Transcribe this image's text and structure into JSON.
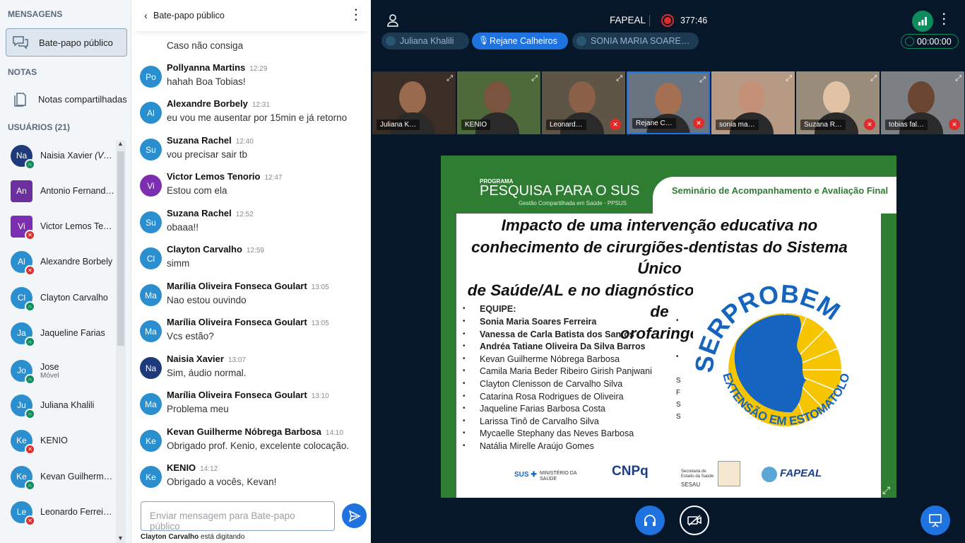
{
  "sidebar": {
    "messages_title": "MENSAGENS",
    "public_chat": "Bate-papo público",
    "notes_title": "NOTAS",
    "shared_notes": "Notas compartilhadas",
    "users_title": "USUÁRIOS (21)",
    "users": [
      {
        "initials": "Na",
        "name": "Naisia Xavier (Você)",
        "sub": "",
        "color": "#1f3a7a",
        "shape": "round",
        "status": "ok"
      },
      {
        "initials": "An",
        "name": "Antonio Fernand…",
        "sub": "",
        "color": "#6b2f9e",
        "shape": "square",
        "status": ""
      },
      {
        "initials": "Vi",
        "name": "Victor Lemos Ten…",
        "sub": "",
        "color": "#7b2fb0",
        "shape": "square",
        "status": "mute"
      },
      {
        "initials": "Al",
        "name": "Alexandre Borbely",
        "sub": "",
        "color": "#2b8fcf",
        "shape": "round",
        "status": "mute"
      },
      {
        "initials": "Cl",
        "name": "Clayton Carvalho",
        "sub": "",
        "color": "#2b8fcf",
        "shape": "round",
        "status": "ok"
      },
      {
        "initials": "Ja",
        "name": "Jaqueline Farias",
        "sub": "",
        "color": "#2b8fcf",
        "shape": "round",
        "status": "ok"
      },
      {
        "initials": "Jo",
        "name": "Jose",
        "sub": "Móvel",
        "color": "#2b8fcf",
        "shape": "round",
        "status": "ok"
      },
      {
        "initials": "Ju",
        "name": "Juliana Khalili",
        "sub": "",
        "color": "#2b8fcf",
        "shape": "round",
        "status": "ok"
      },
      {
        "initials": "Ke",
        "name": "KENIO",
        "sub": "",
        "color": "#2b8fcf",
        "shape": "round",
        "status": "mute"
      },
      {
        "initials": "Ke",
        "name": "Kevan Guilherme…",
        "sub": "",
        "color": "#2b8fcf",
        "shape": "round",
        "status": "ok"
      },
      {
        "initials": "Le",
        "name": "Leonardo Ferreir…",
        "sub": "",
        "color": "#2b8fcf",
        "shape": "round",
        "status": "mute"
      }
    ]
  },
  "chat": {
    "title": "Bate-papo público",
    "partial_text": "Caso não consiga",
    "messages": [
      {
        "initials": "Po",
        "color": "#2b8fcf",
        "name": "Pollyanna Martins",
        "time": "12:29",
        "text": "hahah Boa Tobias!"
      },
      {
        "initials": "Al",
        "color": "#2b8fcf",
        "name": "Alexandre Borbely",
        "time": "12:31",
        "text": "eu vou me ausentar por 15min e já retorno"
      },
      {
        "initials": "Su",
        "color": "#2b8fcf",
        "name": "Suzana Rachel",
        "time": "12:40",
        "text": "vou precisar sair tb"
      },
      {
        "initials": "Vi",
        "color": "#7b2fb0",
        "name": "Victor Lemos Tenorio",
        "time": "12:47",
        "text": "Estou com ela"
      },
      {
        "initials": "Su",
        "color": "#2b8fcf",
        "name": "Suzana Rachel",
        "time": "12:52",
        "text": "obaaa!!"
      },
      {
        "initials": "Cl",
        "color": "#2b8fcf",
        "name": "Clayton Carvalho",
        "time": "12:59",
        "text": "simm"
      },
      {
        "initials": "Ma",
        "color": "#2b8fcf",
        "name": "Marília Oliveira Fonseca Goulart",
        "time": "13:05",
        "text": "Nao estou ouvindo"
      },
      {
        "initials": "Ma",
        "color": "#2b8fcf",
        "name": "Marília Oliveira Fonseca Goulart",
        "time": "13:05",
        "text": "Vcs estão?"
      },
      {
        "initials": "Na",
        "color": "#1f3a7a",
        "name": "Naisia Xavier",
        "time": "13:07",
        "text": "Sim, áudio normal."
      },
      {
        "initials": "Ma",
        "color": "#2b8fcf",
        "name": "Marília Oliveira Fonseca Goulart",
        "time": "13:10",
        "text": "Problema meu"
      },
      {
        "initials": "Ke",
        "color": "#2b8fcf",
        "name": "Kevan Guilherme Nóbrega Barbosa",
        "time": "14:10",
        "text": "Obrigado prof. Kenio, excelente colocação."
      },
      {
        "initials": "Ke",
        "color": "#2b8fcf",
        "name": "KENIO",
        "time": "14:12",
        "text": "Obrigado a vocês, Kevan!"
      }
    ],
    "input_placeholder": "Enviar mensagem para Bate-papo público",
    "typing_name": "Clayton Carvalho",
    "typing_text": "está digitando"
  },
  "meeting": {
    "title": "FAPEAL",
    "rec_time": "377:46",
    "timer": "00:00:00",
    "talkers": [
      "Juliana Khalili",
      "Rejane Calheiros",
      "SONIA MARIA SOARE…"
    ],
    "tiles": [
      {
        "name": "Juliana K…"
      },
      {
        "name": "KENIO"
      },
      {
        "name": "Leonard…"
      },
      {
        "name": "Rejane C…"
      },
      {
        "name": "sonia ma…"
      },
      {
        "name": "Suzana R…"
      },
      {
        "name": "tobias fal…"
      }
    ]
  },
  "slide": {
    "program_small": "PROGRAMA",
    "program": "PESQUISA PARA O SUS",
    "program_sub": "Gestão Compartilhada em Saúde · PPSUS",
    "seminar": "Seminário de Acompanhamento e Avaliação Final",
    "title_lines": [
      "Impacto de uma intervenção educativa no",
      "conhecimento de cirurgiões-dentistas do Sistema Único",
      "de Saúde/AL e no diagnóstico do câncer de boca e de",
      "orofaringe"
    ],
    "team_label": "EQUIPE:",
    "team": [
      {
        "name": "Sonia Maria Soares Ferreira",
        "bold": true
      },
      {
        "name": "Vanessa de Carla Batista dos Santos",
        "bold": true
      },
      {
        "name": "Andréa Tatiane Oliveira Da Silva Barros",
        "bold": true
      },
      {
        "name": "Kevan Guilherme Nóbrega Barbosa",
        "bold": false
      },
      {
        "name": "Camila Maria Beder Ribeiro Girish Panjwani",
        "bold": false
      },
      {
        "name": "Clayton Clenisson de Carvalho Silva",
        "bold": false
      },
      {
        "name": "Catarina Rosa Rodrigues de Oliveira",
        "bold": false
      },
      {
        "name": "Jaqueline Farias Barbosa Costa",
        "bold": false
      },
      {
        "name": "Larissa Tinô de Carvalho Silva",
        "bold": false
      },
      {
        "name": "Mycaelle Stephany das Neves Barbosa",
        "bold": false
      },
      {
        "name": "Natália Mirelle Araújo Gomes",
        "bold": false
      }
    ],
    "serprobem": "SERPROBEM",
    "extensao": "EXTENSÃO EM ESTOMATOLOGIA",
    "logos": {
      "sus": "SUS",
      "ministerio": "MINISTÉRIO DA SAÚDE",
      "cnpq": "CNPq",
      "sesau_top": "Secretaria de Estado da Saúde",
      "sesau": "SESAU",
      "fapeal": "FAPEAL"
    }
  }
}
